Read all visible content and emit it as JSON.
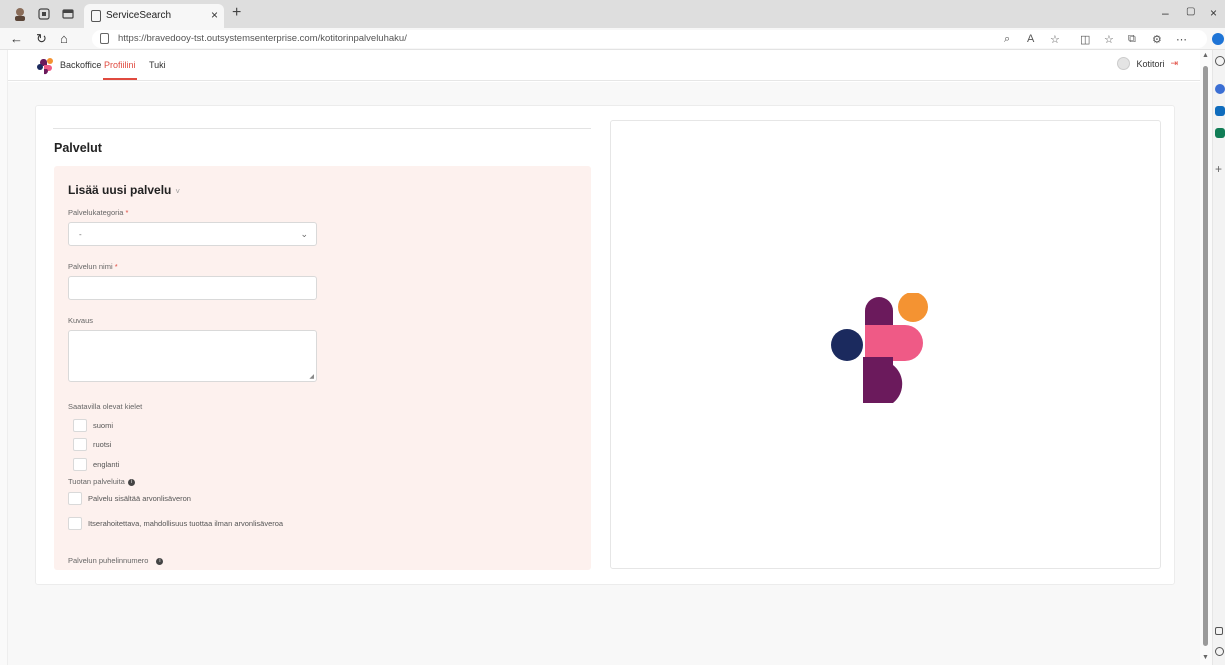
{
  "browser": {
    "tab_title": "ServiceSearch",
    "tab_close": "×",
    "new_tab": "+",
    "url": "https://bravedooy-tst.outsystemsenterprise.com/kotitorinpalveluhaku/",
    "win_min": "–",
    "win_max": "▢",
    "win_close": "×"
  },
  "header": {
    "nav": [
      {
        "label": "Backoffice"
      },
      {
        "label": "Profiilini"
      },
      {
        "label": "Tuki"
      }
    ],
    "user_name": "Kotitori",
    "logout_glyph": "⇥"
  },
  "page": {
    "section_title": "Palvelut",
    "form": {
      "title": "Lisää uusi palvelu",
      "title_chevron": "˅",
      "category_label": "Palvelukategoria",
      "required_mark": "*",
      "category_value": "-",
      "name_label": "Palvelun nimi",
      "description_label": "Kuvaus",
      "languages_label": "Saatavilla olevat kielet",
      "languages": [
        {
          "label": "suomi"
        },
        {
          "label": "ruotsi"
        },
        {
          "label": "englanti"
        }
      ],
      "produce_label": "Tuotan palveluita",
      "produce_options": [
        {
          "label": "Palvelu sisältää arvonlisäveron"
        },
        {
          "label": "Itserahoitettava, mahdollisuus tuottaa ilman arvonlisäveroa"
        }
      ],
      "phone_label": "Palvelun puhelinnumero",
      "info_glyph": "i"
    }
  },
  "colors": {
    "accent": "#e04a3f",
    "form_bg": "#fdf1ee",
    "logo_purple": "#6b1a5c",
    "logo_pink": "#ef5a86",
    "logo_orange": "#f49332",
    "logo_navy": "#1b2a5e"
  }
}
